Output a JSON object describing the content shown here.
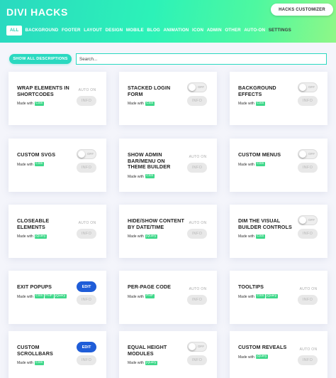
{
  "header": {
    "title": "DIVI HACKS",
    "customizer_label": "HACKS CUSTOMIZER",
    "gradient": [
      "#2ad9c0",
      "#8ff787"
    ]
  },
  "nav": [
    {
      "label": "ALL",
      "active": true
    },
    {
      "label": "BACKGROUND"
    },
    {
      "label": "FOOTER"
    },
    {
      "label": "LAYOUT"
    },
    {
      "label": "DESIGN"
    },
    {
      "label": "MOBILE"
    },
    {
      "label": "BLOG"
    },
    {
      "label": "ANIMATION"
    },
    {
      "label": "ICON"
    },
    {
      "label": "ADMIN"
    },
    {
      "label": "OTHER"
    },
    {
      "label": "AUTO-ON"
    },
    {
      "label": "SETTINGS",
      "dark": true
    }
  ],
  "toolbar": {
    "show_all_label": "SHOW ALL DESCRIPTIONS",
    "search_placeholder": "Search..."
  },
  "labels": {
    "made_with": "Made with",
    "auto_on": "AUTO ON",
    "off": "OFF",
    "edit": "EDIT",
    "info": "INFO"
  },
  "colors": {
    "accent": "#2ad9c0",
    "edit": "#1f5dd8",
    "tag": "#3fd88a"
  },
  "cards": [
    {
      "title": "WRAP ELEMENTS IN SHORTCODES",
      "control": "auto",
      "tags": [
        "CSS"
      ]
    },
    {
      "title": "STACKED LOGIN FORM",
      "control": "toggle",
      "tags": [
        "CSS"
      ]
    },
    {
      "title": "BACKGROUND EFFECTS",
      "control": "toggle",
      "tags": [
        "CSS"
      ]
    },
    {
      "title": "CUSTOM SVGS",
      "control": "toggle",
      "tags": [
        "CSS"
      ]
    },
    {
      "title": "SHOW ADMIN BAR/MENU ON THEME BUILDER",
      "control": "auto",
      "tags": [
        "CSS"
      ]
    },
    {
      "title": "CUSTOM MENUS",
      "control": "toggle",
      "tags": [
        "CSS"
      ]
    },
    {
      "title": "CLOSEABLE ELEMENTS",
      "control": "auto",
      "tags": [
        "jQuery"
      ]
    },
    {
      "title": "HIDE/SHOW CONTENT BY DATE/TIME",
      "control": "auto",
      "tags": [
        "jQuery"
      ]
    },
    {
      "title": "DIM THE VISUAL BUILDER CONTROLS",
      "control": "toggle",
      "tags": [
        "CSS"
      ]
    },
    {
      "title": "EXIT POPUPS",
      "control": "edit",
      "tags": [
        "CSS",
        "PHP",
        "jQuery"
      ]
    },
    {
      "title": "PER-PAGE CODE",
      "control": "auto",
      "tags": [
        "PHP"
      ]
    },
    {
      "title": "TOOLTIPS",
      "control": "auto",
      "tags": [
        "CSS",
        "jQuery"
      ]
    },
    {
      "title": "CUSTOM SCROLLBARS",
      "control": "edit",
      "tags": [
        "CSS"
      ]
    },
    {
      "title": "EQUAL HEIGHT MODULES",
      "control": "toggle",
      "tags": [
        "jQuery"
      ]
    },
    {
      "title": "CUSTOM REVEALS",
      "control": "auto",
      "tags": [
        "jQuery"
      ]
    }
  ]
}
